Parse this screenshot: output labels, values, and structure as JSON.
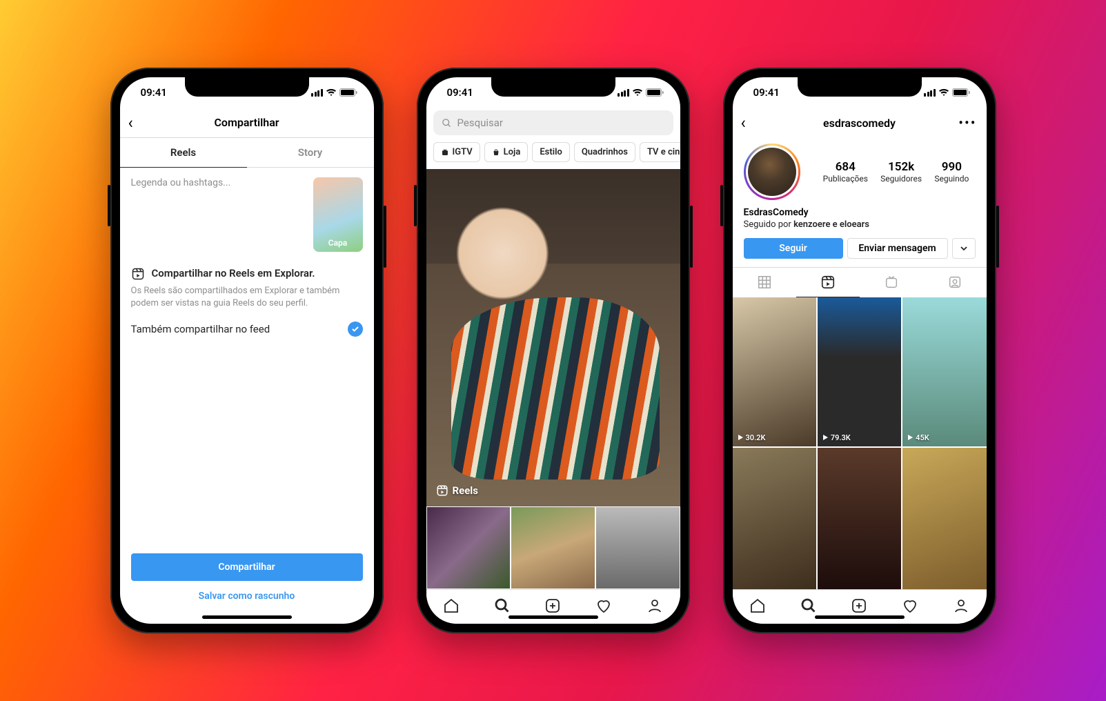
{
  "statusTime": "09:41",
  "phone1": {
    "headerTitle": "Compartilhar",
    "tabs": {
      "reels": "Reels",
      "story": "Story"
    },
    "captionPlaceholder": "Legenda ou hashtags...",
    "thumbLabel": "Capa",
    "shareExploreTitle": "Compartilhar no Reels em Explorar.",
    "shareExploreDesc": "Os Reels são compartilhados em Explorar e também podem ser vistas na guia Reels do seu perfil.",
    "alsoFeed": "Também compartilhar no feed",
    "shareButton": "Compartilhar",
    "saveDraft": "Salvar como rascunho"
  },
  "phone2": {
    "searchPlaceholder": "Pesquisar",
    "chips": [
      "IGTV",
      "Loja",
      "Estilo",
      "Quadrinhos",
      "TV e cin"
    ],
    "reelsLabel": "Reels"
  },
  "phone3": {
    "username": "esdrascomedy",
    "stats": {
      "posts": {
        "value": "684",
        "label": "Publicações"
      },
      "followers": {
        "value": "152k",
        "label": "Seguidores"
      },
      "following": {
        "value": "990",
        "label": "Seguindo"
      }
    },
    "displayName": "EsdrasComedy",
    "followedByPrefix": "Seguido por ",
    "followedByNames": "kenzoere e eloears",
    "followButton": "Seguir",
    "messageButton": "Enviar mensagem",
    "reelViews": [
      "30.2K",
      "79.3K",
      "45K"
    ]
  }
}
